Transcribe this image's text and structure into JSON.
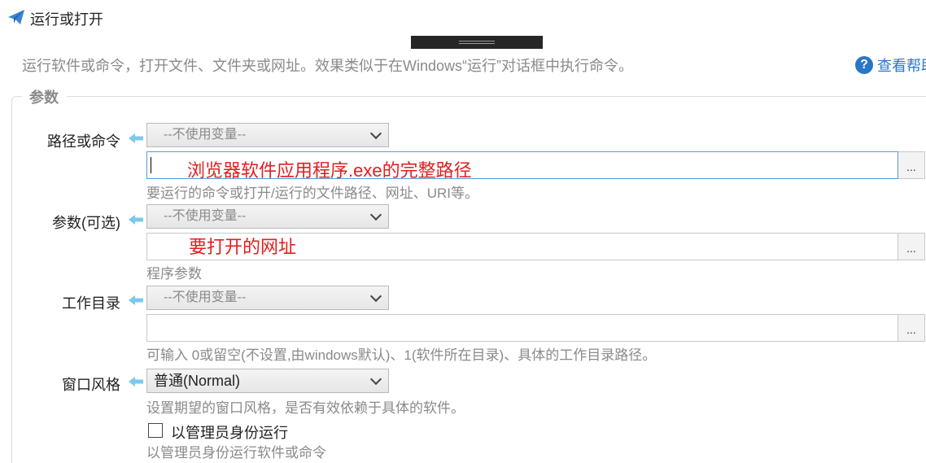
{
  "header": {
    "title": "运行或打开",
    "description": "运行软件或命令，打开文件、文件夹或网址。效果类似于在Windows“运行”对话框中执行命令。",
    "help_label": "查看帮助"
  },
  "params": {
    "group_title": "参数",
    "path": {
      "label": "路径或命令",
      "variable_select": "--不使用变量--",
      "value": "",
      "annotation": "浏览器软件应用程序.exe的完整路径",
      "browse_label": "...",
      "hint": "要运行的命令或打开/运行的文件路径、网址、URI等。"
    },
    "args": {
      "label": "参数(可选)",
      "variable_select": "--不使用变量--",
      "value": "",
      "annotation": "要打开的网址",
      "browse_label": "...",
      "hint": "程序参数"
    },
    "workdir": {
      "label": "工作目录",
      "variable_select": "--不使用变量--",
      "value": "",
      "browse_label": "...",
      "hint": "可输入 0或留空(不设置,由windows默认)、1(软件所在目录)、具体的工作目录路径。"
    },
    "window_style": {
      "label": "窗口风格",
      "selected": "普通(Normal)",
      "hint": "设置期望的窗口风格，是否有效依赖于具体的软件。"
    },
    "run_as_admin": {
      "label": "以管理员身份运行",
      "checked": false,
      "hint": "以管理员身份运行软件或命令"
    }
  },
  "colors": {
    "accent": "#2a76c6",
    "annotation": "#e11e1e",
    "arrow": "#7cc8ee"
  }
}
